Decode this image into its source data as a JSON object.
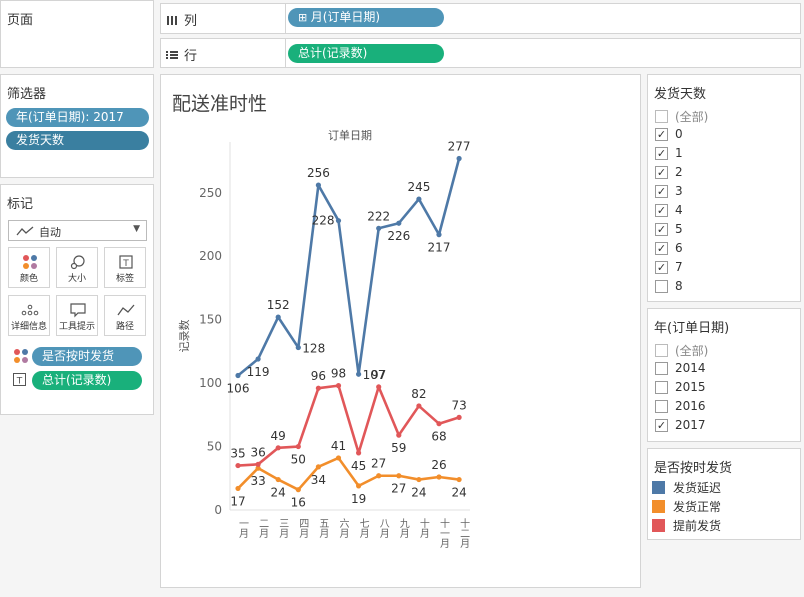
{
  "pages_shelf": {
    "title": "页面"
  },
  "columns_shelf": {
    "label": "列",
    "pill": "月(订单日期)"
  },
  "rows_shelf": {
    "label": "行",
    "pill": "总计(记录数)"
  },
  "filters": {
    "title": "筛选器",
    "pills": [
      "年(订单日期): 2017",
      "发货天数"
    ]
  },
  "marks": {
    "title": "标记",
    "mark_type": "自动",
    "buttons": [
      "颜色",
      "大小",
      "标签",
      "详细信息",
      "工具提示",
      "路径"
    ],
    "fields": [
      "是否按时发货",
      "总计(记录数)"
    ]
  },
  "worksheet": {
    "title": "配送准时性"
  },
  "ship_days_filter": {
    "title": "发货天数",
    "items": [
      {
        "label": "(全部)",
        "checked": false,
        "all": true
      },
      {
        "label": "0",
        "checked": true
      },
      {
        "label": "1",
        "checked": true
      },
      {
        "label": "2",
        "checked": true
      },
      {
        "label": "3",
        "checked": true
      },
      {
        "label": "4",
        "checked": true
      },
      {
        "label": "5",
        "checked": true
      },
      {
        "label": "6",
        "checked": true
      },
      {
        "label": "7",
        "checked": true
      },
      {
        "label": "8",
        "checked": false
      }
    ]
  },
  "year_filter": {
    "title": "年(订单日期)",
    "items": [
      {
        "label": "(全部)",
        "checked": false,
        "all": true
      },
      {
        "label": "2014",
        "checked": false
      },
      {
        "label": "2015",
        "checked": false
      },
      {
        "label": "2016",
        "checked": false
      },
      {
        "label": "2017",
        "checked": true
      }
    ]
  },
  "legend": {
    "title": "是否按时发货",
    "items": [
      {
        "label": "发货延迟",
        "color": "#4e79a7"
      },
      {
        "label": "发货正常",
        "color": "#f28e2b"
      },
      {
        "label": "提前发货",
        "color": "#e15759"
      }
    ]
  },
  "chart_data": {
    "type": "line",
    "title": "",
    "xlabel": "订单日期",
    "ylabel": "记录数",
    "categories": [
      "一月",
      "二月",
      "三月",
      "四月",
      "五月",
      "六月",
      "七月",
      "八月",
      "九月",
      "十月",
      "十一月",
      "十二月"
    ],
    "ylim": [
      0,
      290
    ],
    "yticks": [
      0,
      50,
      100,
      150,
      200,
      250
    ],
    "grid": false,
    "series": [
      {
        "name": "发货延迟",
        "color": "#4e79a7",
        "values": [
          106,
          119,
          152,
          128,
          256,
          228,
          107,
          222,
          226,
          245,
          217,
          277
        ]
      },
      {
        "name": "发货正常",
        "color": "#f28e2b",
        "values": [
          17,
          33,
          24,
          16,
          34,
          41,
          19,
          27,
          27,
          24,
          26,
          24
        ]
      },
      {
        "name": "提前发货",
        "color": "#e15759",
        "values": [
          35,
          36,
          49,
          50,
          96,
          98,
          45,
          97,
          59,
          82,
          68,
          73
        ]
      }
    ]
  }
}
